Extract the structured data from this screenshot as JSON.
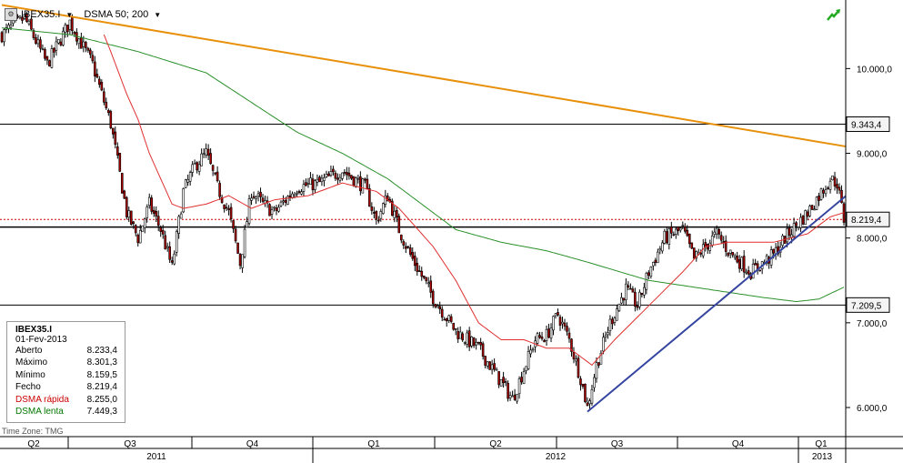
{
  "header": {
    "symbol": "IBEX35.I",
    "indicator": "DSMA 50; 200"
  },
  "timezone": "Time Zone: TMG",
  "legend": {
    "title": "IBEX35.I",
    "date": "01-Fev-2013",
    "rows": [
      {
        "label": "Aberto",
        "value": "8.233,4",
        "color": "#000000"
      },
      {
        "label": "Máximo",
        "value": "8.301,3",
        "color": "#000000"
      },
      {
        "label": "Mínimo",
        "value": "8.159,5",
        "color": "#000000"
      },
      {
        "label": "Fecho",
        "value": "8.219,4",
        "color": "#000000"
      },
      {
        "label": "DSMA rápida",
        "value": "8.255,0",
        "color": "#cc0000"
      },
      {
        "label": "DSMA lenta",
        "value": "7.449,3",
        "color": "#007700"
      }
    ]
  },
  "chart_data": {
    "type": "candlestick",
    "y_ticks": [
      "10.000,0",
      "9.000,0",
      "8.000,0",
      "7.000,0",
      "6.000,0"
    ],
    "y_tick_values": [
      10000,
      9000,
      8000,
      7000,
      6000
    ],
    "price_tags": [
      {
        "label": "9.343,4",
        "value": 9343.4,
        "style": "horizontal-line"
      },
      {
        "label": "8.219,4",
        "value": 8219.4,
        "style": "last-price"
      },
      {
        "label": "7.209,5",
        "value": 7209.5,
        "style": "horizontal-line"
      }
    ],
    "extra_horizontal_lines": [
      8130
    ],
    "quarters": [
      "Q2",
      "Q3",
      "Q4",
      "Q1",
      "Q2",
      "Q3",
      "Q4",
      "Q1"
    ],
    "years": [
      "2011",
      "2012",
      "2013"
    ],
    "grid": false,
    "series": [
      {
        "name": "DSMA rápida",
        "color": "#e03030"
      },
      {
        "name": "DSMA lenta",
        "color": "#2a902a"
      }
    ],
    "close_anchors": [
      [
        0,
        10400
      ],
      [
        10,
        10600
      ],
      [
        20,
        10050
      ],
      [
        30,
        10550
      ],
      [
        40,
        10050
      ],
      [
        48,
        9350
      ],
      [
        55,
        8300
      ],
      [
        60,
        8000
      ],
      [
        65,
        8400
      ],
      [
        70,
        8100
      ],
      [
        75,
        7650
      ],
      [
        80,
        8550
      ],
      [
        85,
        8850
      ],
      [
        90,
        9000
      ],
      [
        95,
        8600
      ],
      [
        100,
        8300
      ],
      [
        105,
        7700
      ],
      [
        110,
        8550
      ],
      [
        115,
        8400
      ],
      [
        120,
        8300
      ],
      [
        130,
        8600
      ],
      [
        140,
        8650
      ],
      [
        150,
        8800
      ],
      [
        155,
        8700
      ],
      [
        160,
        8600
      ],
      [
        165,
        8200
      ],
      [
        170,
        8500
      ],
      [
        175,
        8100
      ],
      [
        180,
        7800
      ],
      [
        190,
        7300
      ],
      [
        200,
        6900
      ],
      [
        210,
        6700
      ],
      [
        220,
        6300
      ],
      [
        225,
        6100
      ],
      [
        235,
        6800
      ],
      [
        240,
        6850
      ],
      [
        245,
        7100
      ],
      [
        250,
        6800
      ],
      [
        255,
        6350
      ],
      [
        258,
        6000
      ],
      [
        262,
        6500
      ],
      [
        268,
        7000
      ],
      [
        275,
        7400
      ],
      [
        280,
        7200
      ],
      [
        285,
        7600
      ],
      [
        292,
        8000
      ],
      [
        300,
        8100
      ],
      [
        305,
        7750
      ],
      [
        315,
        8050
      ],
      [
        320,
        7850
      ],
      [
        330,
        7600
      ],
      [
        340,
        7800
      ],
      [
        345,
        8000
      ],
      [
        350,
        8150
      ],
      [
        355,
        8300
      ],
      [
        360,
        8500
      ],
      [
        365,
        8700
      ],
      [
        368,
        8650
      ],
      [
        371,
        8219
      ]
    ],
    "fast_ma_anchors": [
      [
        45,
        10400
      ],
      [
        48,
        10200
      ],
      [
        55,
        9700
      ],
      [
        60,
        9400
      ],
      [
        65,
        9000
      ],
      [
        70,
        8700
      ],
      [
        75,
        8400
      ],
      [
        80,
        8350
      ],
      [
        90,
        8400
      ],
      [
        100,
        8500
      ],
      [
        110,
        8350
      ],
      [
        120,
        8450
      ],
      [
        135,
        8500
      ],
      [
        150,
        8650
      ],
      [
        165,
        8550
      ],
      [
        175,
        8350
      ],
      [
        190,
        7900
      ],
      [
        200,
        7500
      ],
      [
        210,
        7000
      ],
      [
        220,
        6800
      ],
      [
        230,
        6800
      ],
      [
        240,
        6700
      ],
      [
        250,
        6700
      ],
      [
        260,
        6500
      ],
      [
        270,
        6800
      ],
      [
        285,
        7200
      ],
      [
        300,
        7600
      ],
      [
        310,
        7900
      ],
      [
        320,
        7950
      ],
      [
        340,
        7950
      ],
      [
        355,
        8050
      ],
      [
        365,
        8250
      ],
      [
        371,
        8300
      ]
    ],
    "slow_ma_anchors": [
      [
        0,
        10480
      ],
      [
        30,
        10400
      ],
      [
        60,
        10200
      ],
      [
        90,
        9950
      ],
      [
        110,
        9600
      ],
      [
        130,
        9250
      ],
      [
        150,
        9000
      ],
      [
        170,
        8700
      ],
      [
        185,
        8400
      ],
      [
        200,
        8100
      ],
      [
        220,
        7950
      ],
      [
        240,
        7850
      ],
      [
        260,
        7700
      ],
      [
        285,
        7500
      ],
      [
        310,
        7400
      ],
      [
        335,
        7300
      ],
      [
        350,
        7250
      ],
      [
        360,
        7280
      ],
      [
        371,
        7420
      ]
    ],
    "trendlines": [
      {
        "name": "resistance",
        "color": "#e8900a",
        "points": [
          [
            0,
            10750
          ],
          [
            372,
            9080
          ]
        ]
      },
      {
        "name": "support",
        "color": "#3646a0",
        "points": [
          [
            258,
            5950
          ],
          [
            372,
            8500
          ]
        ]
      }
    ]
  }
}
